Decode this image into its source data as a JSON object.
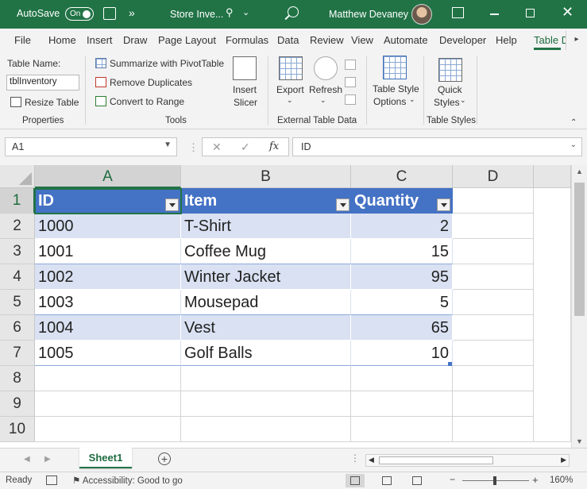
{
  "titlebar": {
    "autosave_label": "AutoSave",
    "autosave_state": "On",
    "filename": "Store Inve...",
    "user_name": "Matthew Devaney",
    "more_glyph": "»"
  },
  "menu": {
    "tabs": [
      "File",
      "Home",
      "Insert",
      "Draw",
      "Page Layout",
      "Formulas",
      "Data",
      "Review",
      "View",
      "Automate",
      "Developer",
      "Help",
      "Table D"
    ],
    "active": "Table D"
  },
  "ribbon": {
    "properties": {
      "table_name_label": "Table Name:",
      "table_name_value": "tblInventory",
      "resize_label": "Resize Table",
      "group_label": "Properties"
    },
    "tools": {
      "pivot_label": "Summarize with PivotTable",
      "dupes_label": "Remove Duplicates",
      "convert_label": "Convert to Range",
      "group_label": "Tools"
    },
    "slicer": {
      "line1": "Insert",
      "line2": "Slicer"
    },
    "external": {
      "export_label": "Export",
      "refresh_label": "Refresh",
      "group_label": "External Table Data"
    },
    "styles": {
      "options_line1": "Table Style",
      "options_line2": "Options",
      "quick_line1": "Quick",
      "quick_line2": "Styles",
      "group_label": "Table Styles"
    }
  },
  "formula_bar": {
    "name_box": "A1",
    "cancel_glyph": "✕",
    "enter_glyph": "✓",
    "fx_glyph": "fx",
    "formula": "ID"
  },
  "sheet": {
    "columns": [
      "A",
      "B",
      "C",
      "D"
    ],
    "rows": [
      "1",
      "2",
      "3",
      "4",
      "5",
      "6",
      "7",
      "8",
      "9",
      "10"
    ],
    "table": {
      "headers": [
        "ID",
        "Item",
        "Quantity"
      ],
      "rows": [
        [
          "1000",
          "T-Shirt",
          "2"
        ],
        [
          "1001",
          "Coffee Mug",
          "15"
        ],
        [
          "1002",
          "Winter Jacket",
          "95"
        ],
        [
          "1003",
          "Mousepad",
          "5"
        ],
        [
          "1004",
          "Vest",
          "65"
        ],
        [
          "1005",
          "Golf Balls",
          "10"
        ]
      ]
    },
    "colors": {
      "header_bg": "#4472c4",
      "band_bg": "#d9e1f2",
      "accent": "#217346"
    }
  },
  "sheet_tabs": {
    "tabs": [
      "Sheet1"
    ],
    "add_glyph": "+"
  },
  "statusbar": {
    "ready": "Ready",
    "accessibility": "Accessibility: Good to go",
    "zoom_minus": "−",
    "zoom_plus": "+",
    "zoom": "160%"
  }
}
